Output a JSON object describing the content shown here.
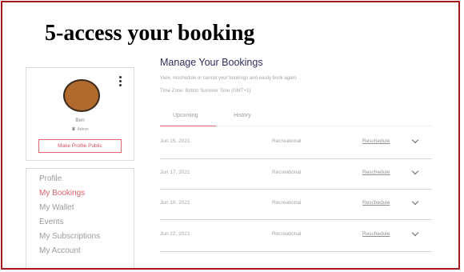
{
  "slide": {
    "title": "5-access your booking"
  },
  "profile": {
    "name": "Ben",
    "role": "Admin",
    "make_public_label": "Make Profile Public"
  },
  "nav": {
    "items": [
      {
        "label": "Profile",
        "active": false
      },
      {
        "label": "My Bookings",
        "active": true
      },
      {
        "label": "My Wallet",
        "active": false
      },
      {
        "label": "Events",
        "active": false
      },
      {
        "label": "My Subscriptions",
        "active": false
      },
      {
        "label": "My Account",
        "active": false
      }
    ]
  },
  "main": {
    "heading": "Manage Your Bookings",
    "subtitle": "View, reschedule or cancel your bookings and easily book again.",
    "timezone": "Time Zone: British Summer Time (GMT+1)",
    "tabs": [
      {
        "label": "Upcoming",
        "active": true
      },
      {
        "label": "History",
        "active": false
      }
    ],
    "bookings": [
      {
        "date": "Jun 15, 2021",
        "type": "Recreational",
        "action": "Reschedule"
      },
      {
        "date": "Jun 17, 2021",
        "type": "Recreational",
        "action": "Reschedule"
      },
      {
        "date": "Jun 19, 2021",
        "type": "Recreational",
        "action": "Reschedule"
      },
      {
        "date": "Jun 22, 2021",
        "type": "Recreational",
        "action": "Reschedule"
      }
    ]
  },
  "colors": {
    "frame_border": "#a31818",
    "accent": "#e0626b",
    "heading": "#2e2f5b",
    "avatar_fill": "#b06a2e"
  },
  "icons": {
    "profile_menu": "kebab-menu-icon",
    "role": "crown-icon",
    "row_expand": "chevron-down-icon"
  }
}
